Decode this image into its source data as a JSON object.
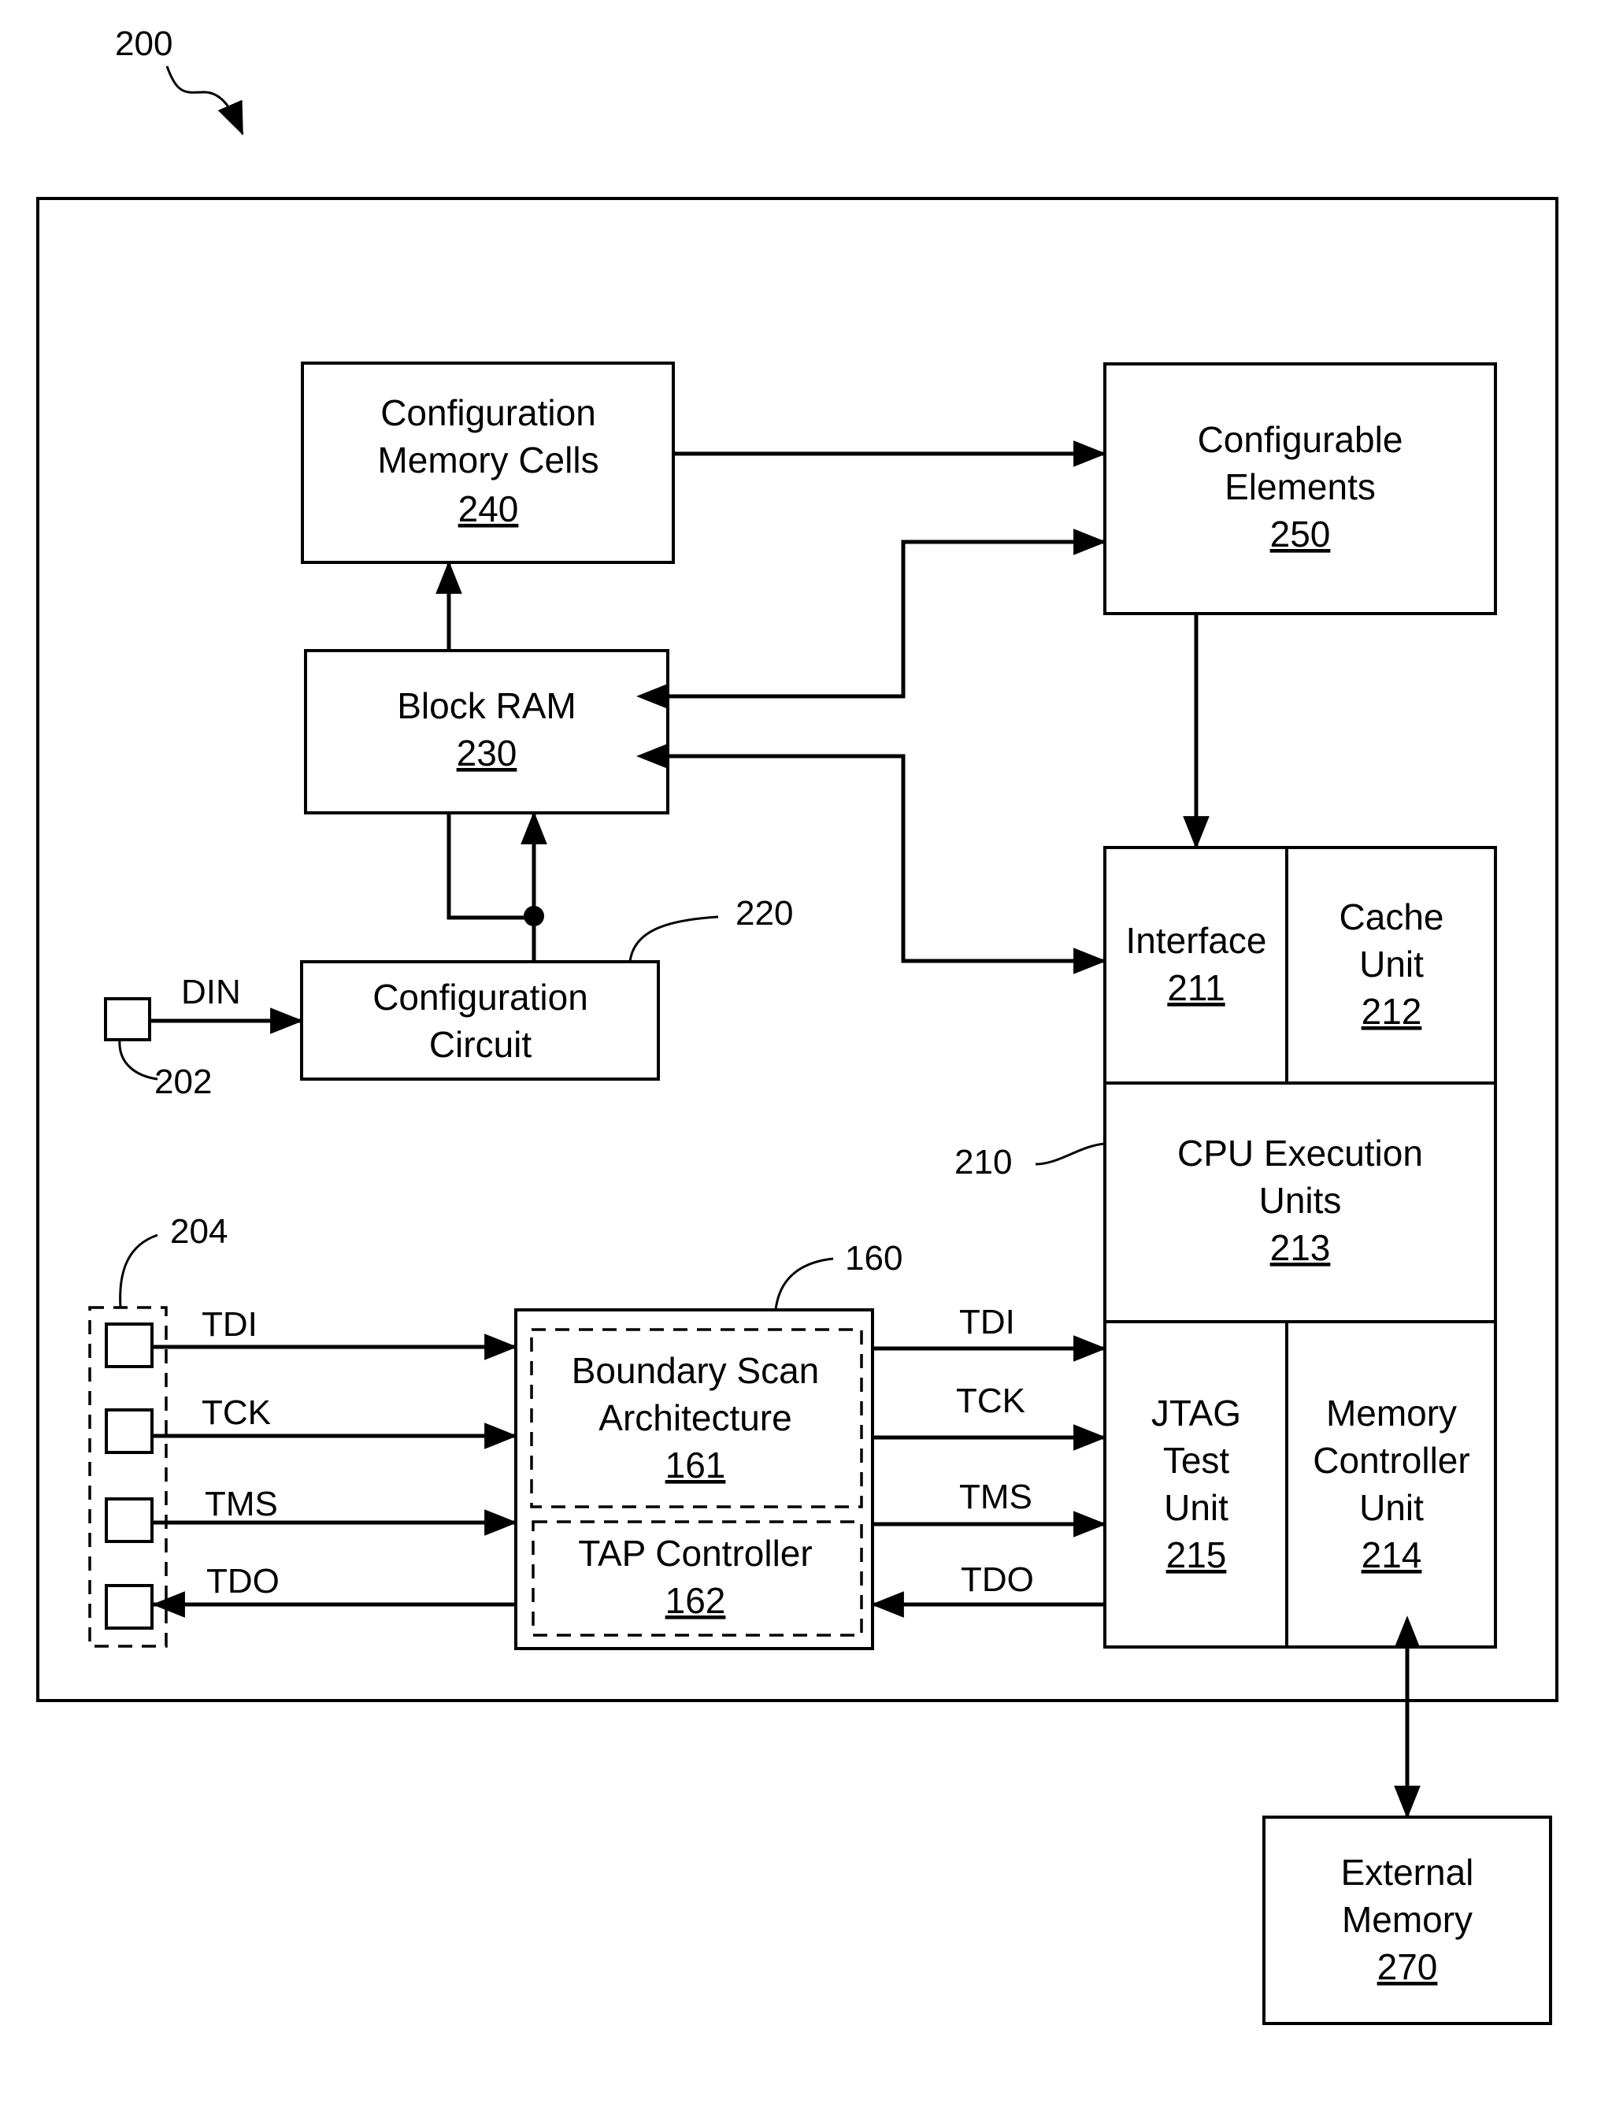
{
  "figure": {
    "ref": "200",
    "colors": {
      "ink": "#000000",
      "background": "#ffffff"
    }
  },
  "blocks": {
    "config_memory": {
      "line1": "Configuration",
      "line2": "Memory Cells",
      "num": "240"
    },
    "configurable_elements": {
      "line1": "Configurable",
      "line2": "Elements",
      "num": "250"
    },
    "block_ram": {
      "line1": "Block RAM",
      "num": "230"
    },
    "config_circuit": {
      "line1": "Configuration",
      "line2": "Circuit",
      "ref": "220"
    },
    "interface": {
      "line1": "Interface",
      "num": "211"
    },
    "cache": {
      "line1": "Cache",
      "line2": "Unit",
      "num": "212"
    },
    "cpu_exec": {
      "line1": "CPU Execution",
      "line2": "Units",
      "num": "213",
      "ref": "210"
    },
    "jtag": {
      "line1": "JTAG",
      "line2": "Test",
      "line3": "Unit",
      "num": "215"
    },
    "mem_ctrl": {
      "line1": "Memory",
      "line2": "Controller",
      "line3": "Unit",
      "num": "214"
    },
    "boundary_scan": {
      "line1": "Boundary Scan",
      "line2": "Architecture",
      "num": "161",
      "ref": "160"
    },
    "tap": {
      "line1": "TAP Controller",
      "num": "162"
    },
    "external_memory": {
      "line1": "External",
      "line2": "Memory",
      "num": "270"
    }
  },
  "pins": {
    "din_ref": "202",
    "jtag_ref": "204",
    "din_label": "DIN"
  },
  "signals": {
    "left": [
      "TDI",
      "TCK",
      "TMS",
      "TDO"
    ],
    "right": [
      "TDI",
      "TCK",
      "TMS",
      "TDO"
    ]
  }
}
